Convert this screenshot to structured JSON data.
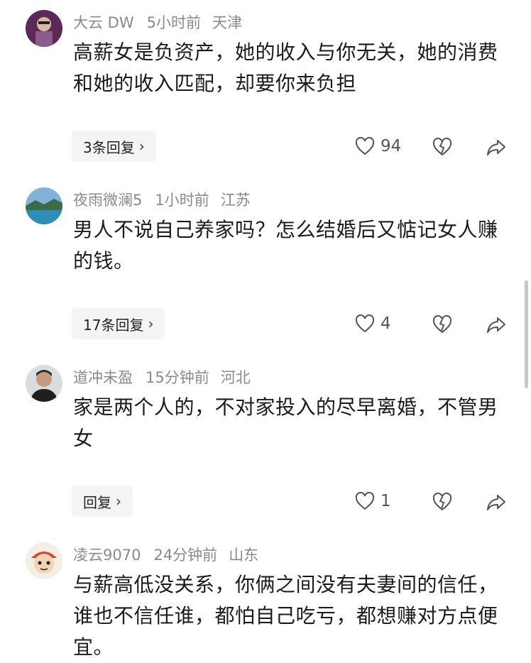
{
  "comments": [
    {
      "username": "大云 DW",
      "time": "5小时前",
      "location": "天津",
      "text": "高薪女是负资产，她的收入与你无关，她的消费和她的收入匹配，却要你来负担",
      "reply_label": "3条回复",
      "likes": "94"
    },
    {
      "username": "夜雨微澜5",
      "time": "1小时前",
      "location": "江苏",
      "text": "男人不说自己养家吗？怎么结婚后又惦记女人赚的钱。",
      "reply_label": "17条回复",
      "likes": "4"
    },
    {
      "username": "道冲未盈",
      "time": "15分钟前",
      "location": "河北",
      "text": "家是两个人的，不对家投入的尽早离婚，不管男女",
      "reply_label": "回复",
      "likes": "1"
    },
    {
      "username": "凌云9070",
      "time": "24分钟前",
      "location": "山东",
      "text": "与薪高低没关系，你俩之间没有夫妻间的信任，谁也不信任谁，都怕自己吃亏，都想赚对方点便宜。"
    }
  ],
  "icons": {
    "like": "heart-outline-icon",
    "dislike": "broken-heart-icon",
    "share": "share-arrow-icon",
    "chevron": "chevron-right-icon"
  },
  "colors": {
    "meta_text": "#8a8a8a",
    "pill_bg": "#f4f4f4"
  }
}
